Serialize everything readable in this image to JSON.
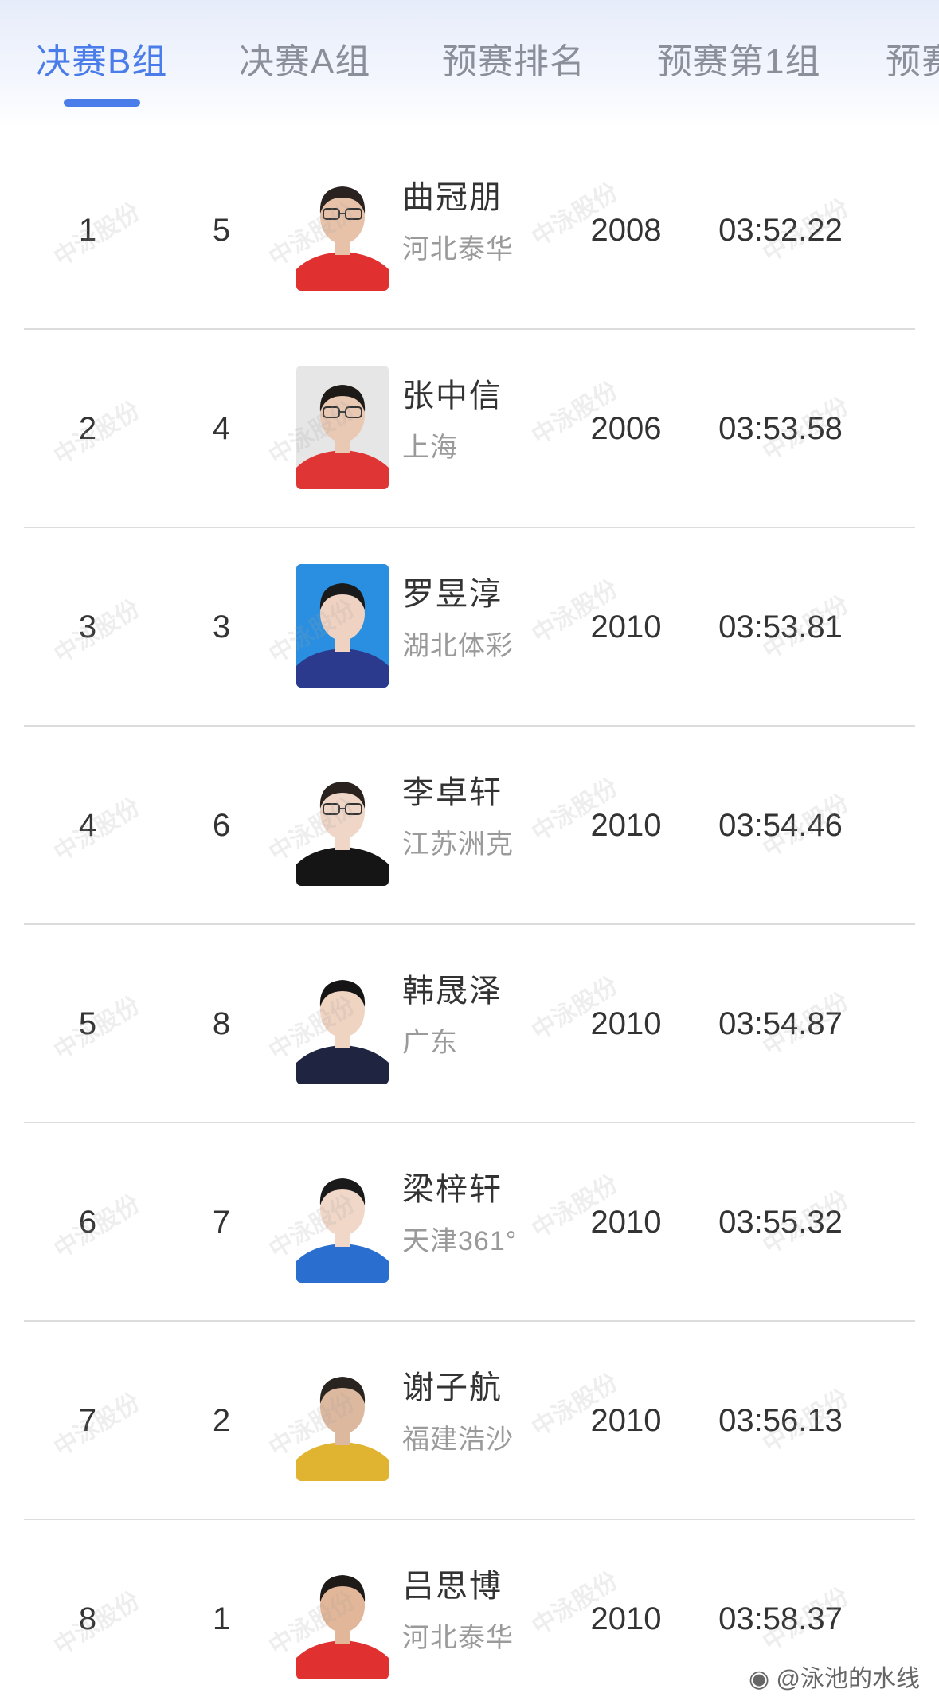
{
  "tabs": [
    {
      "label": "决赛B组",
      "active": true
    },
    {
      "label": "决赛A组",
      "active": false
    },
    {
      "label": "预赛排名",
      "active": false
    },
    {
      "label": "预赛第1组",
      "active": false
    },
    {
      "label": "预赛",
      "active": false
    }
  ],
  "results": [
    {
      "rank": "1",
      "lane": "5",
      "name": "曲冠朋",
      "team": "河北泰华",
      "year": "2008",
      "time": "03:52.22",
      "photo": {
        "bg": "#ffffff",
        "shirt": "#e03030",
        "hair": "#2a2220",
        "skin": "#e8c2a8",
        "glasses": true
      }
    },
    {
      "rank": "2",
      "lane": "4",
      "name": "张中信",
      "team": "上海",
      "year": "2006",
      "time": "03:53.58",
      "photo": {
        "bg": "#e6e6e6",
        "shirt": "#e03535",
        "hair": "#1e1a18",
        "skin": "#e9c9b4",
        "glasses": true
      }
    },
    {
      "rank": "3",
      "lane": "3",
      "name": "罗昱淳",
      "team": "湖北体彩",
      "year": "2010",
      "time": "03:53.81",
      "photo": {
        "bg": "#2a8fe0",
        "shirt": "#2b3a8c",
        "hair": "#1a1a1a",
        "skin": "#efd2c2",
        "glasses": false
      }
    },
    {
      "rank": "4",
      "lane": "6",
      "name": "李卓轩",
      "team": "江苏洲克",
      "year": "2010",
      "time": "03:54.46",
      "photo": {
        "bg": "#ffffff",
        "shirt": "#151515",
        "hair": "#2a221e",
        "skin": "#f0d6c6",
        "glasses": true
      }
    },
    {
      "rank": "5",
      "lane": "8",
      "name": "韩晟泽",
      "team": "广东",
      "year": "2010",
      "time": "03:54.87",
      "photo": {
        "bg": "#ffffff",
        "shirt": "#1f2540",
        "hair": "#151515",
        "skin": "#f0d4c2",
        "glasses": false
      }
    },
    {
      "rank": "6",
      "lane": "7",
      "name": "梁梓轩",
      "team": "天津361°",
      "year": "2010",
      "time": "03:55.32",
      "photo": {
        "bg": "#ffffff",
        "shirt": "#2a6fd0",
        "hair": "#1a1a1a",
        "skin": "#f1d7c8",
        "glasses": false
      }
    },
    {
      "rank": "7",
      "lane": "2",
      "name": "谢子航",
      "team": "福建浩沙",
      "year": "2010",
      "time": "03:56.13",
      "photo": {
        "bg": "#ffffff",
        "shirt": "#e0b430",
        "hair": "#2a2420",
        "skin": "#dcb89e",
        "glasses": false
      }
    },
    {
      "rank": "8",
      "lane": "1",
      "name": "吕思博",
      "team": "河北泰华",
      "year": "2010",
      "time": "03:58.37",
      "photo": {
        "bg": "#ffffff",
        "shirt": "#e03030",
        "hair": "#1e1a18",
        "skin": "#e2b698",
        "glasses": false
      }
    }
  ],
  "watermark_text": "中泳股份",
  "weibo_credit": "@泳池的水线",
  "colors": {
    "accent": "#4a7de9",
    "divider": "#dcdcdc",
    "secondary_text": "#9a9a9a"
  }
}
